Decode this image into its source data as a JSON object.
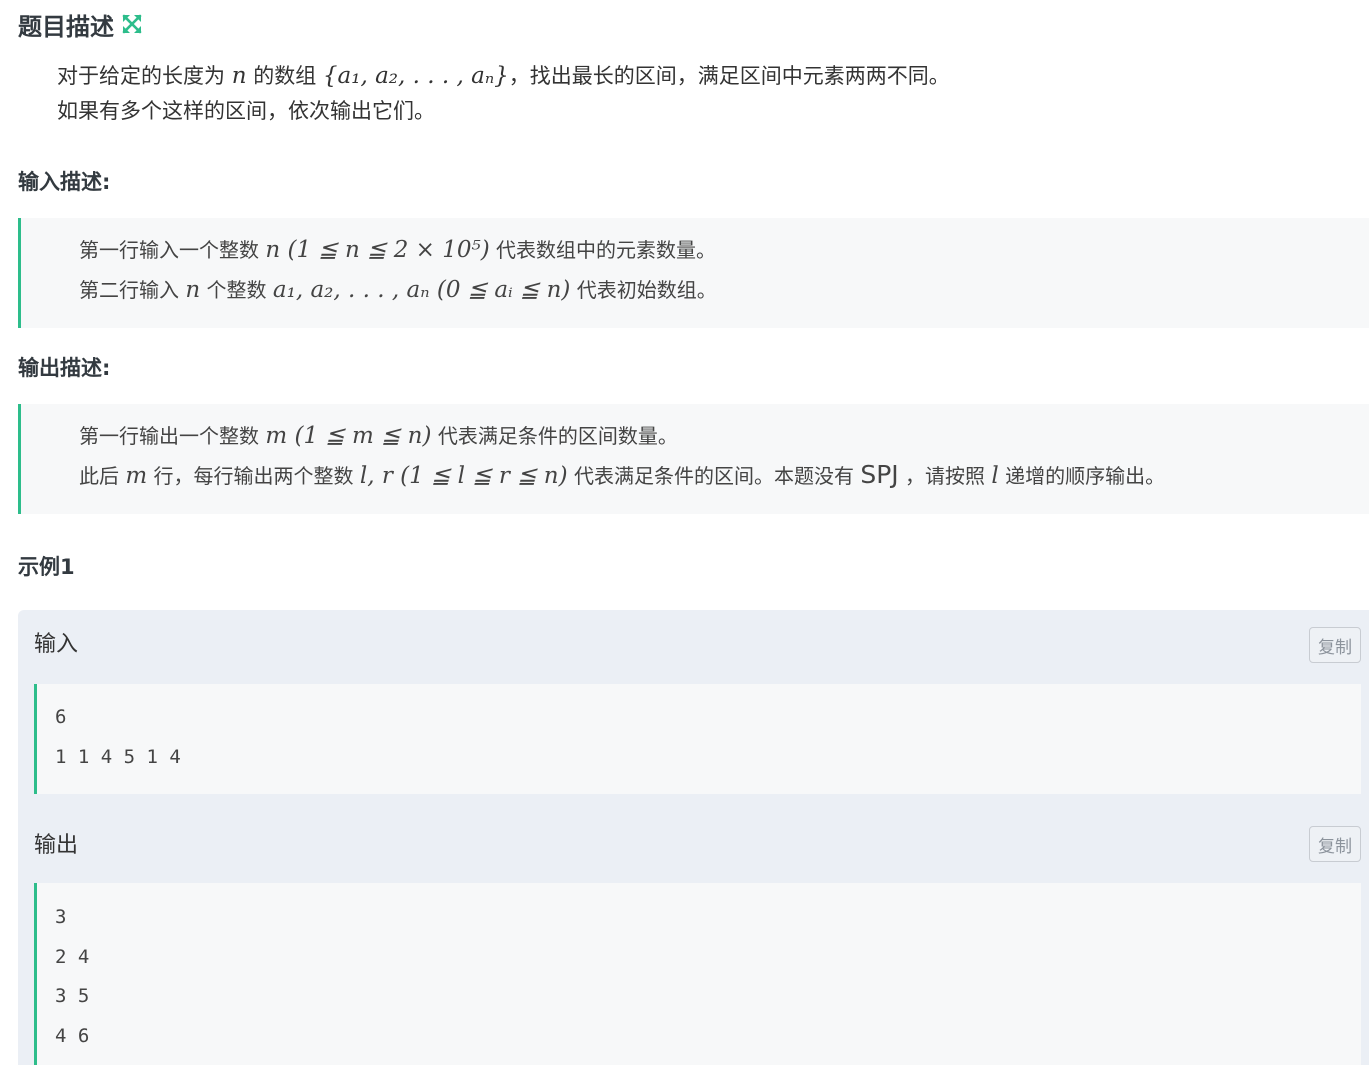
{
  "problem": {
    "title": "题目描述",
    "desc_line1_a": "对于给定的长度为 ",
    "desc_line1_var": "n",
    "desc_line1_b": " 的数组 ",
    "desc_line1_math": "{a₁, a₂, . . . , aₙ}",
    "desc_line1_c": "，找出最长的区间，满足区间中元素两两不同。",
    "desc_line2": "如果有多个这样的区间，依次输出它们。"
  },
  "input_section": {
    "title": "输入描述:",
    "line1_a": "第一行输入一个整数 ",
    "line1_math": "n (1 ≦ n ≦ 2 × 10⁵)",
    "line1_b": " 代表数组中的元素数量。",
    "line2_a": "第二行输入 ",
    "line2_var": "n",
    "line2_b": " 个整数 ",
    "line2_math": "a₁, a₂, . . . , aₙ (0 ≦ aᵢ ≦ n)",
    "line2_c": " 代表初始数组。"
  },
  "output_section": {
    "title": "输出描述:",
    "line1_a": "第一行输出一个整数 ",
    "line1_math": "m (1 ≦ m ≦ n)",
    "line1_b": " 代表满足条件的区间数量。",
    "line2_a": "此后 ",
    "line2_var": "m",
    "line2_b": " 行，每行输出两个整数 ",
    "line2_math": "l, r (1 ≦ l ≦ r ≦ n)",
    "line2_c": " 代表满足条件的区间。本题没有 ",
    "line2_spj": "SPJ",
    "line2_d": " ，请按照 ",
    "line2_var2": "l",
    "line2_e": " 递增的顺序输出。"
  },
  "example": {
    "title": "示例1",
    "input_label": "输入",
    "output_label": "输出",
    "copy_label": "复制",
    "input_lines": [
      "6",
      "1 1 4 5 1 4"
    ],
    "output_lines": [
      "3",
      "2 4",
      "3 5",
      "4 6"
    ]
  },
  "icons": {
    "expand": "expand-arrows-icon"
  },
  "colors": {
    "accent": "#2dbd8b",
    "quote_bg": "#f7f8f9",
    "example_bg": "#ebeff5"
  }
}
